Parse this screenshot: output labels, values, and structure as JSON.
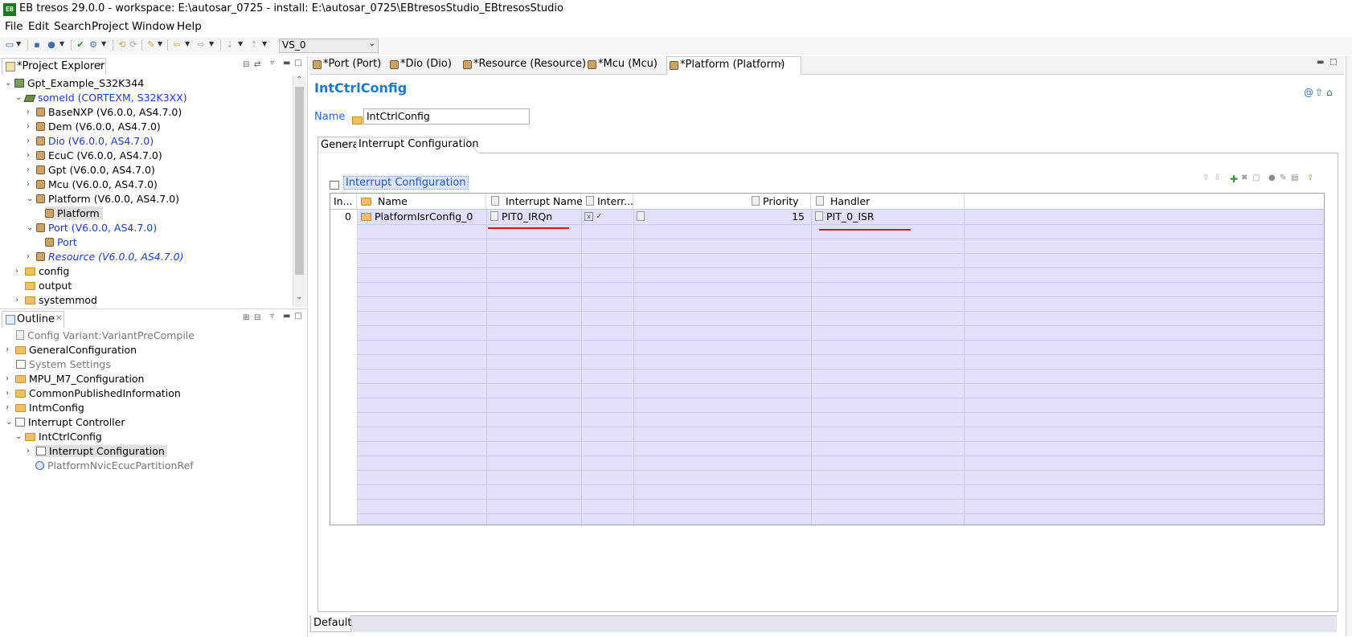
{
  "window": {
    "title": "EB tresos 29.0.0 - workspace: E:\\autosar_0725 - install: E:\\autosar_0725\\EBtresosStudio_EBtresosStudio",
    "logo_text": "EB"
  },
  "menu": [
    "File",
    "Edit",
    "Search",
    "Project",
    "Window",
    "Help"
  ],
  "toolbar": {
    "variant_combo": "VS_0"
  },
  "project_explorer": {
    "title": "*Project Explorer",
    "items": [
      {
        "label": "Gpt_Example_S32K344"
      },
      {
        "label": "someId (CORTEXM, S32K3XX)"
      },
      {
        "label": "BaseNXP (V6.0.0, AS4.7.0)"
      },
      {
        "label": "Dem (V6.0.0, AS4.7.0)"
      },
      {
        "label": "Dio (V6.0.0, AS4.7.0)"
      },
      {
        "label": "EcuC (V6.0.0, AS4.7.0)"
      },
      {
        "label": "Gpt (V6.0.0, AS4.7.0)"
      },
      {
        "label": "Mcu (V6.0.0, AS4.7.0)"
      },
      {
        "label": "Platform (V6.0.0, AS4.7.0)"
      },
      {
        "label": "Platform"
      },
      {
        "label": "Port (V6.0.0, AS4.7.0)"
      },
      {
        "label": "Port"
      },
      {
        "label": "Resource (V6.0.0, AS4.7.0)"
      },
      {
        "label": "config"
      },
      {
        "label": "output"
      },
      {
        "label": "systemmod"
      }
    ]
  },
  "outline": {
    "title": "Outline",
    "items": [
      {
        "label": "Config Variant:VariantPreCompile"
      },
      {
        "label": "GeneralConfiguration"
      },
      {
        "label": "System Settings"
      },
      {
        "label": "MPU_M7_Configuration"
      },
      {
        "label": "CommonPublishedInformation"
      },
      {
        "label": "IntmConfig"
      },
      {
        "label": "Interrupt Controller"
      },
      {
        "label": "IntCtrlConfig"
      },
      {
        "label": "Interrupt Configuration"
      },
      {
        "label": "PlatformNvicEcucPartitionRef"
      }
    ]
  },
  "editor_tabs": [
    {
      "label": "*Port (Port)"
    },
    {
      "label": "*Dio (Dio)"
    },
    {
      "label": "*Resource (Resource)"
    },
    {
      "label": "*Mcu (Mcu)"
    },
    {
      "label": "*Platform (Platform)"
    }
  ],
  "editor": {
    "heading": "IntCtrlConfig",
    "name_label": "Name",
    "name_value": "IntCtrlConfig",
    "subtabs": [
      "General",
      "Interrupt Configuration"
    ],
    "section_title": "Interrupt Configuration",
    "table": {
      "headers": [
        "In...",
        "Name",
        "Interrupt Name",
        "Interr...",
        "Priority",
        "Handler"
      ],
      "rows": [
        {
          "index": "0",
          "name": "PlatformIsrConfig_0",
          "interrupt_name": "PIT0_IRQn",
          "priority": "15",
          "handler": "PIT_0_ISR"
        }
      ]
    },
    "bottom_tab": "Default"
  },
  "colors": {
    "table_fill": "#e0e0fa",
    "annotation_red": "#e0111a",
    "heading_blue": "#1f78c8"
  }
}
